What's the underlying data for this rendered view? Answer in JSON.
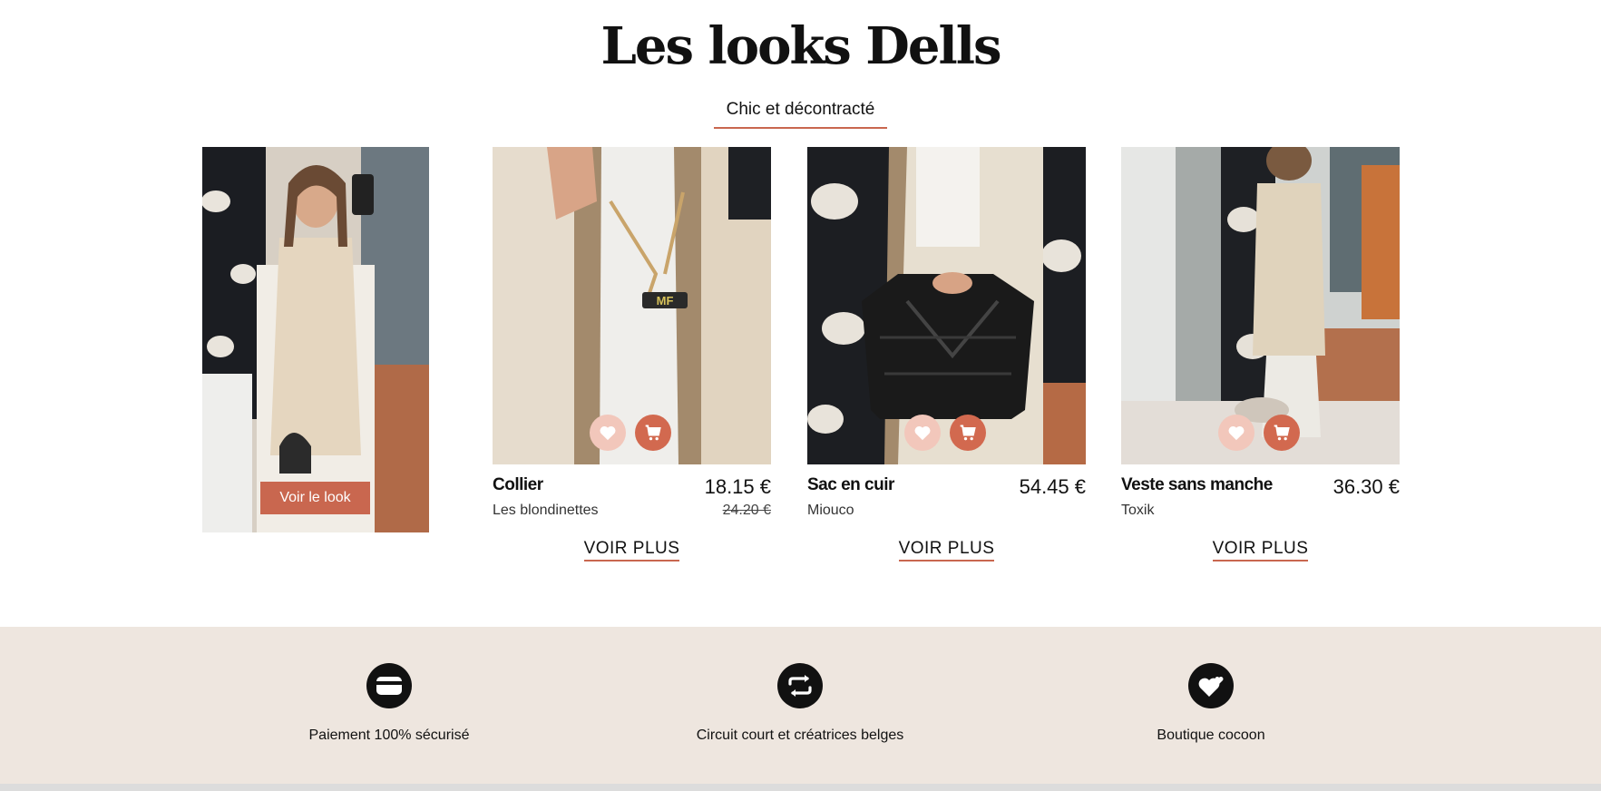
{
  "section": {
    "title": "Les looks Dells",
    "tab_label": "Chic et décontracté"
  },
  "look": {
    "button_label": "Voir le look"
  },
  "products": [
    {
      "name": "Collier",
      "brand": "Les blondinettes",
      "price": "18.15 €",
      "old_price": "24.20 €",
      "more_label": "VOIR PLUS"
    },
    {
      "name": "Sac en cuir",
      "brand": "Miouco",
      "price": "54.45 €",
      "more_label": "VOIR PLUS"
    },
    {
      "name": "Veste sans manche",
      "brand": "Toxik",
      "price": "36.30 €",
      "more_label": "VOIR PLUS"
    }
  ],
  "features": [
    {
      "icon": "credit-card-icon",
      "label": "Paiement 100% sécurisé"
    },
    {
      "icon": "exchange-arrows-icon",
      "label": "Circuit court et créatrices belges"
    },
    {
      "icon": "heart-icon",
      "label": "Boutique cocoon"
    }
  ],
  "colors": {
    "accent": "#c9674f",
    "favorite_button": "#f2c7bb",
    "cart_button": "#d2694f",
    "band_background": "#eee6df"
  }
}
